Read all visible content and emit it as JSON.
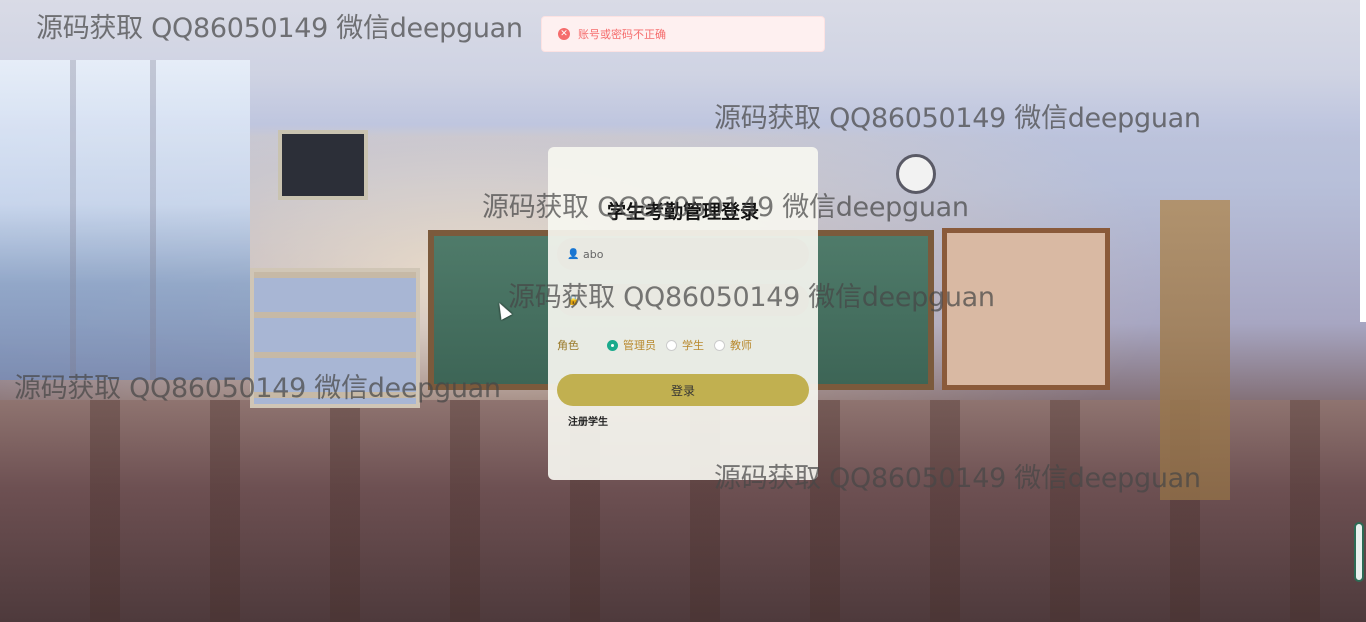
{
  "toast": {
    "message": "账号或密码不正确",
    "type": "error"
  },
  "login": {
    "title": "学生考勤管理登录",
    "username_value": "abo",
    "password_value": "",
    "role_label": "角色",
    "roles": [
      {
        "label": "管理员",
        "selected": true
      },
      {
        "label": "学生",
        "selected": false
      },
      {
        "label": "教师",
        "selected": false
      }
    ],
    "login_button": "登录",
    "register_link": "注册学生"
  },
  "watermark": {
    "text": "源码获取 QQ86050149 微信deepguan"
  },
  "colors": {
    "accent_button": "#c1b050",
    "radio_selected": "#1aaa8c",
    "error": "#f56c6c"
  }
}
